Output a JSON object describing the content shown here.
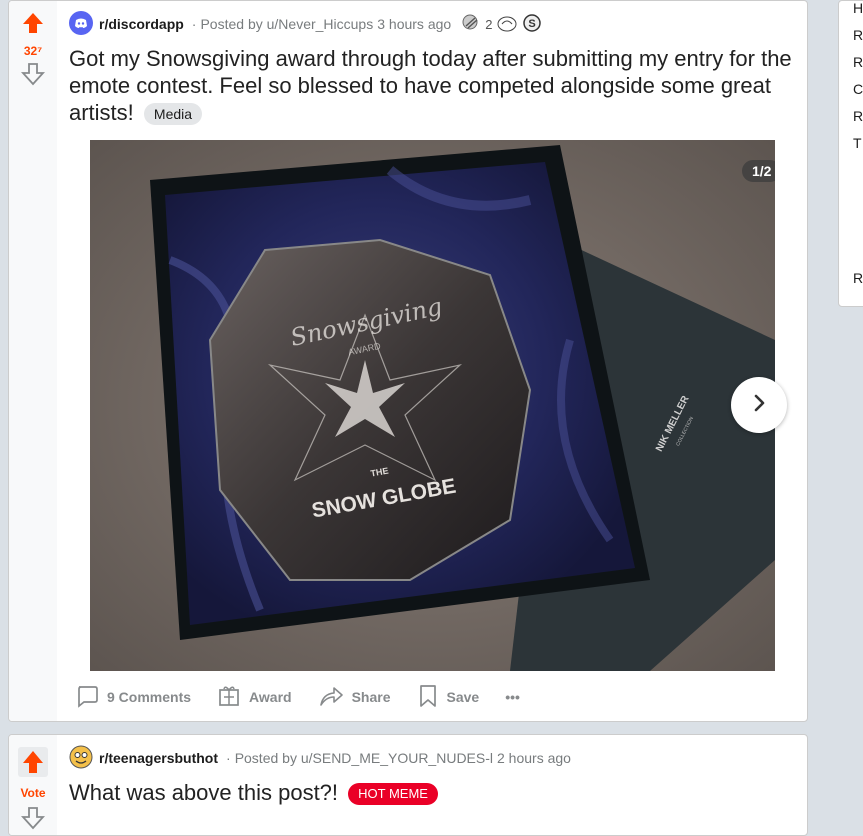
{
  "post1": {
    "score": "32⁷",
    "subreddit": "r/discordapp",
    "posted_by": "Posted by u/Never_Hiccups",
    "time": "3 hours ago",
    "award_count": "2",
    "title": "Got my Snowsgiving award through today after submitting my entry for the emote contest. Feel so blessed to have competed alongside some great artists!",
    "flair": "Media",
    "image_counter": "1/2",
    "image_text": {
      "brand": "Snowsgiving",
      "award": "AWARD",
      "the": "THE",
      "snow_globe": "SNOW GLOBE",
      "box_brand": "NIK MELLER",
      "box_sub": "COLLECTION"
    },
    "actions": {
      "comments": "9 Comments",
      "award": "Award",
      "share": "Share",
      "save": "Save",
      "more": "•••"
    }
  },
  "post2": {
    "vote_label": "Vote",
    "subreddit": "r/teenagersbuthot",
    "posted_by": "Posted by u/SEND_ME_YOUR_NUDES-l",
    "time": "2 hours ago",
    "title": "What was above this post?!",
    "flair": "HOT MEME"
  },
  "sidebar_letters": [
    "H",
    "R",
    "R",
    "C",
    "R",
    "T",
    "",
    "",
    "",
    "",
    "R"
  ],
  "colors": {
    "upvote": "#ff4500",
    "discord": "#5865f2",
    "hot_meme": "#ea0027"
  }
}
